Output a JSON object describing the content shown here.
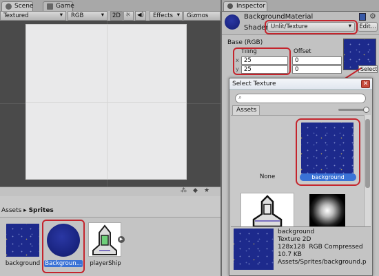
{
  "scene": {
    "tabs": [
      "Scene",
      "Game"
    ],
    "toolbar": {
      "render_mode": "Textured",
      "color_mode": "RGB",
      "mode_2d": "2D",
      "effects": "Effects",
      "gizmos": "Gizmos"
    }
  },
  "project": {
    "breadcrumb": [
      "Assets",
      "Sprites"
    ],
    "assets": [
      {
        "label": "background",
        "icon": "texture-thumbnail"
      },
      {
        "label": "Backgroun...",
        "icon": "material-sphere"
      },
      {
        "label": "playerShip",
        "icon": "ship-sprite"
      }
    ]
  },
  "inspector": {
    "tab": "Inspector",
    "material_name": "BackgroundMaterial",
    "shader_label": "Shader",
    "shader_value": "Unlit/Texture",
    "edit_button": "Edit...",
    "base_label": "Base (RGB)",
    "tiling_label": "Tiling",
    "offset_label": "Offset",
    "x_label": "x",
    "y_label": "y",
    "tiling_x": "25",
    "tiling_y": "25",
    "offset_x": "0",
    "offset_y": "0",
    "select_button": "Select"
  },
  "select_texture": {
    "title": "Select Texture",
    "search_placeholder": "",
    "section": "Assets",
    "none_label": "None",
    "selected_label": "background",
    "details": {
      "name": "background",
      "type": "Texture 2D",
      "info": "128x128  RGB Compressed",
      "size": "10.7 KB",
      "path": "Assets/Sprites/background.p"
    }
  },
  "colors": {
    "highlight_red": "#c4242c",
    "selection_blue": "#3a72d6",
    "texture_blue": "#1d2a8c"
  }
}
